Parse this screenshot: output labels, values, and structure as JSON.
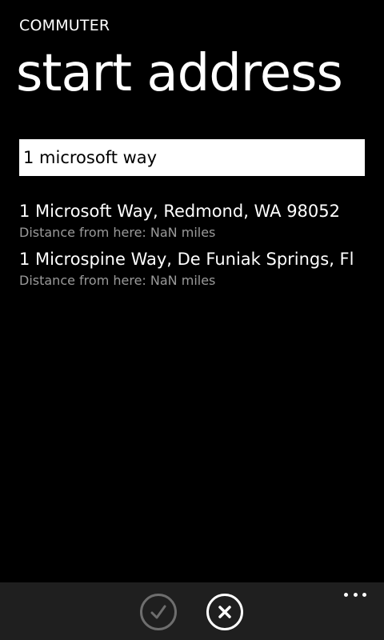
{
  "header": {
    "app_title": "COMMUTER",
    "page_title": "start address"
  },
  "search": {
    "value": "1 microsoft way"
  },
  "results": [
    {
      "address": "1 Microsoft Way, Redmond, WA 98052",
      "distance": "Distance from here: NaN miles"
    },
    {
      "address": "1 Microspine Way, De Funiak Springs, Fl",
      "distance": "Distance from here: NaN miles"
    }
  ],
  "app_bar": {
    "confirm_icon": "check-icon",
    "confirm_enabled": false,
    "cancel_icon": "close-icon",
    "more_icon": "ellipsis-icon"
  },
  "colors": {
    "background": "#000000",
    "text": "#ffffff",
    "secondary_text": "#9a9a9a",
    "app_bar": "#1f1f1f",
    "disabled": "#6e6e6e"
  }
}
